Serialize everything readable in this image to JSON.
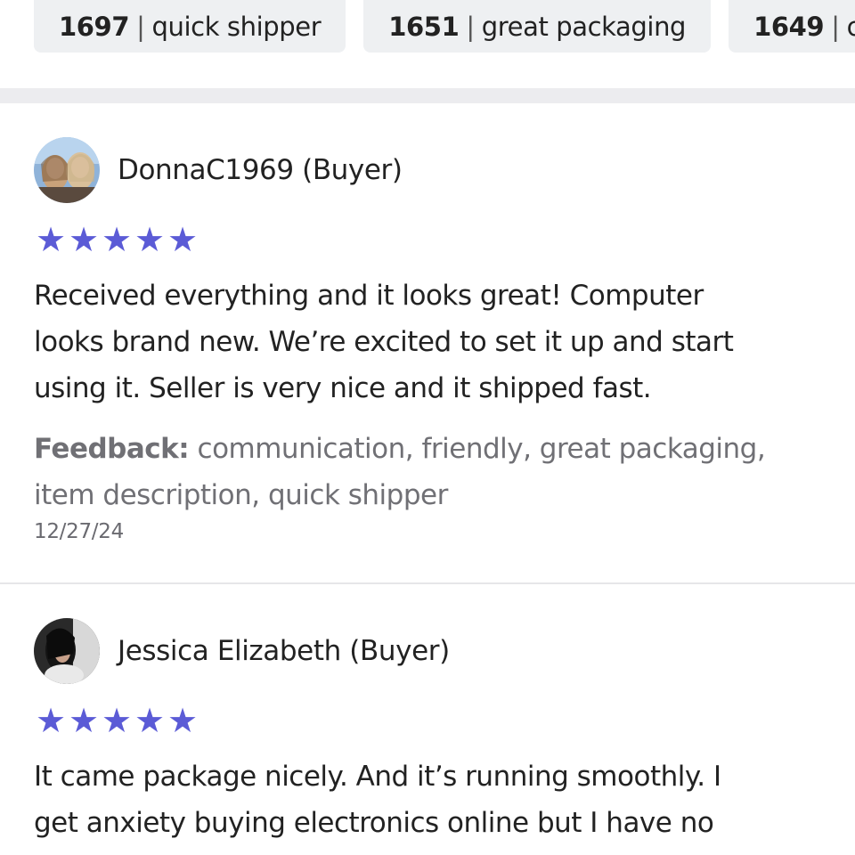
{
  "tags": [
    {
      "count": "1697",
      "label": "quick shipper"
    },
    {
      "count": "1651",
      "label": "great packaging"
    },
    {
      "count": "1649",
      "label": "co"
    }
  ],
  "reviews": [
    {
      "reviewer": "DonnaC1969 (Buyer)",
      "rating": 5,
      "text_lines": [
        "Received everything and it looks great! Computer",
        "looks brand new. We’re excited to set it up and start",
        "using it. Seller is very nice and it shipped fast."
      ],
      "feedback_label": "Feedback:",
      "feedback_lines": [
        " communication, friendly, great packaging,",
        "item description, quick shipper"
      ],
      "date": "12/27/24"
    },
    {
      "reviewer": "Jessica Elizabeth (Buyer)",
      "rating": 5,
      "text_lines": [
        "It came package nicely. And it’s running smoothly. I",
        "get anxiety buying electronics online but I have no"
      ]
    }
  ],
  "colors": {
    "star": "#5b5bd6",
    "chip_bg": "#eef0f2",
    "divider": "#ececef",
    "feedback_text": "#707075"
  },
  "icons": {
    "star": "star-icon",
    "avatar": "user-avatar"
  }
}
